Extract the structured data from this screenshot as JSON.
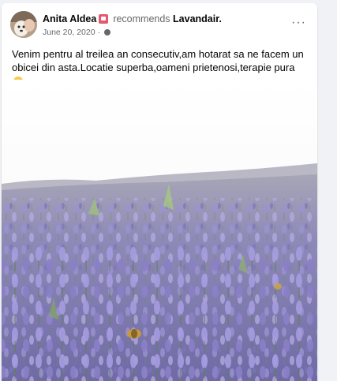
{
  "post": {
    "author": "Anita Aldea",
    "verb": "recommends",
    "page": "Lavandair.",
    "date": "June 20, 2020",
    "date_sep": "·",
    "text": "Venim pentru al treilea an consecutiv,am hotarat sa ne facem un obicei din asta.Locatie superba,oameni prietenosi,terapie pura",
    "more_label": "···"
  },
  "icons": {
    "badge": "recommendation-badge-icon",
    "privacy": "globe-icon",
    "emoji": "smiling-face-emoji",
    "more": "more-options-icon"
  },
  "colors": {
    "lavender": "#8c82c4",
    "sky": "#ffffff",
    "text": "#050505",
    "meta": "#65676b",
    "badge": "#e4596e"
  }
}
